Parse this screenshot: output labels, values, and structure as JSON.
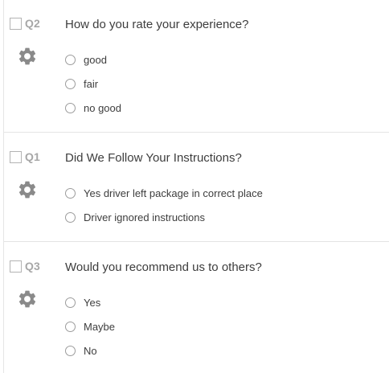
{
  "questions": [
    {
      "number": "Q2",
      "title": "How do you rate your experience?",
      "options": [
        "good",
        "fair",
        "no good"
      ]
    },
    {
      "number": "Q1",
      "title": "Did We Follow Your Instructions?",
      "options": [
        "Yes driver left package in correct place",
        "Driver ignored instructions"
      ]
    },
    {
      "number": "Q3",
      "title": "Would you recommend us to others?",
      "options": [
        "Yes",
        "Maybe",
        "No"
      ]
    }
  ],
  "icons": {
    "question_select": "checkbox-icon",
    "question_settings": "gear-icon",
    "choice": "radio-icon"
  },
  "colors": {
    "question_number": "#a7a7a7",
    "gear": "#8a8a8a",
    "divider": "#e4e4e4"
  }
}
